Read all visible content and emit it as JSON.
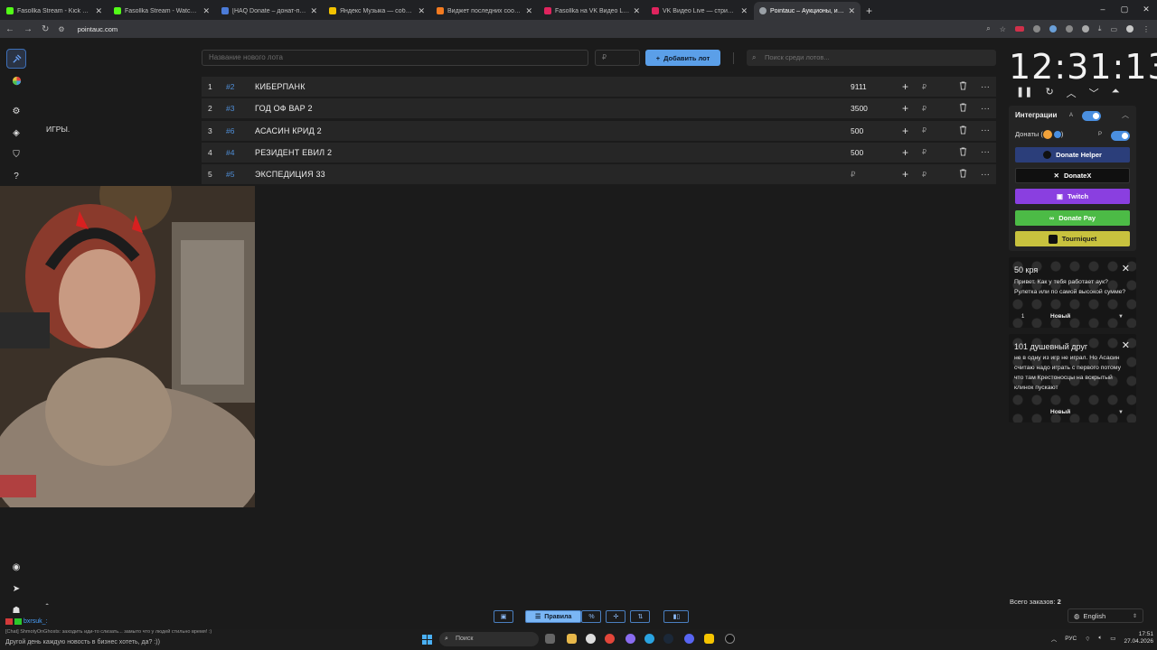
{
  "browser": {
    "tabs": [
      {
        "label": "Fasollka Stream - Kick Dashboard",
        "color": "#53fc18"
      },
      {
        "label": "Fasollka Stream - Watch Live on Kick",
        "color": "#53fc18"
      },
      {
        "label": "[НАQ Donate – донат-платформа",
        "color": "#4b7bd8"
      },
      {
        "label": "Яндекс Музыка — собираем",
        "color": "#f2c200"
      },
      {
        "label": "Виджет последних сообщений",
        "color": "#f47b20"
      },
      {
        "label": "Fasollka на VK Видео Live — стрим",
        "color": "#e0245e"
      },
      {
        "label": "VK Видео Live — стримы, прям",
        "color": "#e0245e"
      },
      {
        "label": "Pointauc – Аукционы, интеракт",
        "color": "#9aa0a6"
      }
    ],
    "new_tab": "+",
    "url": "pointauc.com",
    "window": {
      "minimize": "–",
      "maximize": "▢",
      "close": "✕"
    }
  },
  "sidebar": {
    "games_label": "ИГРЫ."
  },
  "toolbar": {
    "lot_placeholder": "Название нового лота",
    "price_placeholder": "₽",
    "add_lot": "Добавить лот",
    "search_placeholder": "Поиск среди лотов..."
  },
  "lots": [
    {
      "num": "1",
      "tag": "#2",
      "name": "КИБЕРПАНК",
      "amount": "9111",
      "currency": "₽"
    },
    {
      "num": "2",
      "tag": "#3",
      "name": "ГОД ОФ ВАР 2",
      "amount": "3500",
      "currency": "₽"
    },
    {
      "num": "3",
      "tag": "#6",
      "name": "АСАСИН КРИД 2",
      "amount": "500",
      "currency": "₽"
    },
    {
      "num": "4",
      "tag": "#4",
      "name": "РЕЗИДЕНТ ЕВИЛ 2",
      "amount": "500",
      "currency": "₽"
    },
    {
      "num": "5",
      "tag": "#5",
      "name": "ЭКСПЕДИЦИЯ 33",
      "amount": "",
      "placeholder": "₽",
      "currency": "₽"
    }
  ],
  "timer": {
    "value": "12:31:13"
  },
  "integrations": {
    "title": "Интеграции",
    "title_badge": "A",
    "donations_label": "Донаты (",
    "donations_paren": ")",
    "donations_badge": "P",
    "buttons": [
      {
        "label": "Donate Helper",
        "bg": "#2b3e7a",
        "fg": "#ffffff"
      },
      {
        "label": "DonateX",
        "bg": "#101010",
        "fg": "#ffffff"
      },
      {
        "label": "Twitch",
        "bg": "#8a3fe0",
        "fg": "#ffffff"
      },
      {
        "label": "Donate Pay",
        "bg": "#4cbb46",
        "fg": "#ffffff"
      },
      {
        "label": "Tourniquet",
        "bg": "#c8c23e",
        "fg": "#1a1a1a"
      }
    ]
  },
  "donations": [
    {
      "title": "50 кря",
      "text": "Привет. Как у тебя работает аук? Рулетка или по самой высокой сумме?",
      "num": "1",
      "status": "Новый"
    },
    {
      "title": "101 душевный друг",
      "text": "не в одну из игр не играл. Но Асасин считаю надо играть с первого потому что там Крестоносцы на вскрытый клинок пускают",
      "num": "",
      "status": "Новый"
    }
  ],
  "footer": {
    "orders_label": "Всего заказов:",
    "orders_count": "2",
    "language": "English",
    "rules_button": "Правила",
    "percent_button": "%"
  },
  "chat": {
    "username": "bxrsuk_:",
    "line1": "[Chat] ShmotyOnGhosts: заходить иди-то слизать... замыто что у людей стильно время! :)",
    "line2": "Другой день каждую новость в бизнес хотеть, да? :))"
  },
  "taskbar": {
    "search": "Поиск",
    "lang": "РУС",
    "time": "17:51",
    "date": "27.04.2026"
  },
  "colors": {
    "accent": "#5b9fe8",
    "tag": "#4f8fd8",
    "background": "#1b1b1b",
    "row": "#262626"
  }
}
